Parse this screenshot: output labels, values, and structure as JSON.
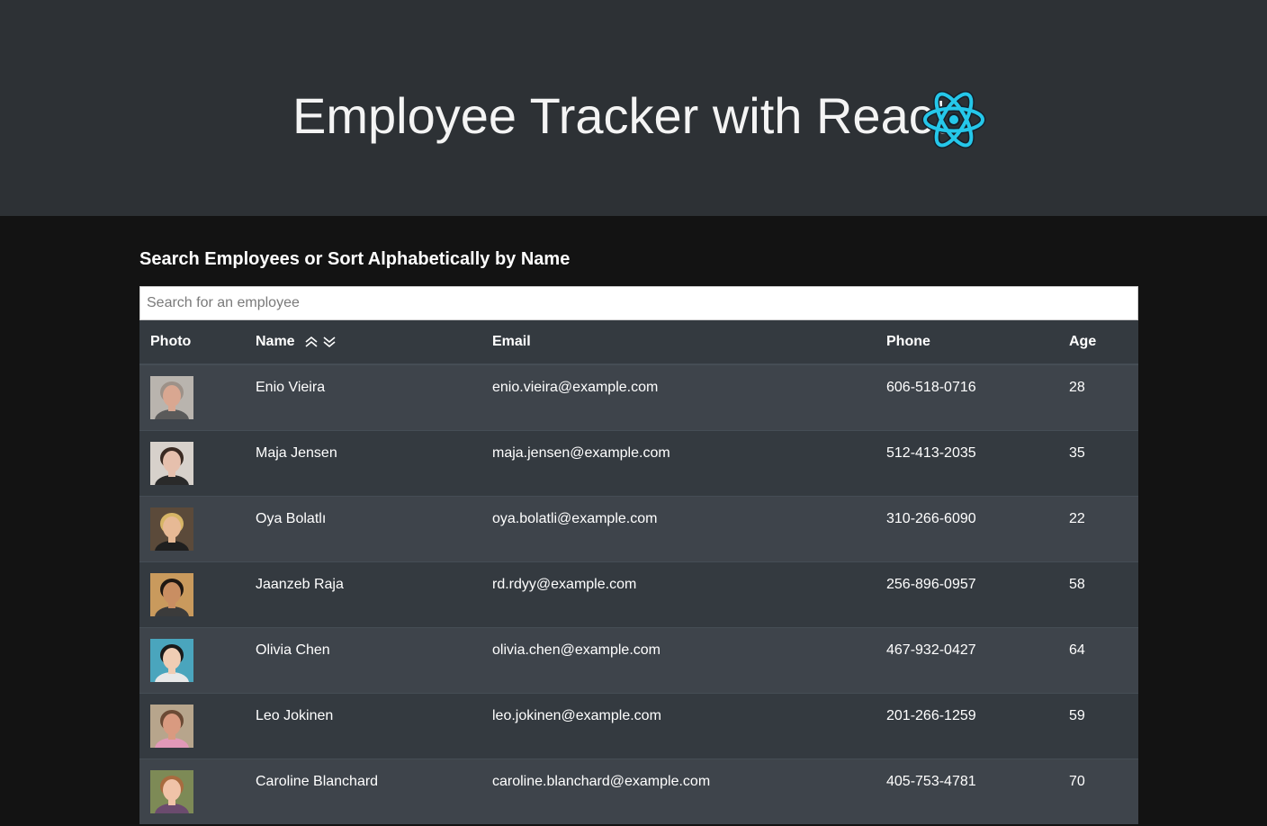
{
  "header": {
    "title": "Employee Tracker with React",
    "logo_icon": "react-logo-icon",
    "background": "#2d3135"
  },
  "search": {
    "heading": "Search Employees or Sort Alphabetically by Name",
    "placeholder": "Search for an employee",
    "value": ""
  },
  "table": {
    "columns": {
      "photo": "Photo",
      "name": "Name",
      "email": "Email",
      "phone": "Phone",
      "age": "Age"
    },
    "sort_icons": [
      "sort-ascending-icon",
      "sort-descending-icon"
    ],
    "rows": [
      {
        "name": "Enio Vieira",
        "email": "enio.vieira@example.com",
        "phone": "606-518-0716",
        "age": "28",
        "avatar": {
          "bg": "#b9b4ae",
          "skin": "#d9a791",
          "hair": "#9d9188",
          "shirt": "#5a5a5a"
        }
      },
      {
        "name": "Maja Jensen",
        "email": "maja.jensen@example.com",
        "phone": "512-413-2035",
        "age": "35",
        "avatar": {
          "bg": "#d7d1cb",
          "skin": "#e6c0ad",
          "hair": "#3a2a22",
          "shirt": "#2a2a2a"
        }
      },
      {
        "name": "Oya Bolatlı",
        "email": "oya.bolatli@example.com",
        "phone": "310-266-6090",
        "age": "22",
        "avatar": {
          "bg": "#5b4a3a",
          "skin": "#e7b995",
          "hair": "#d7b566",
          "shirt": "#1f1f1f"
        }
      },
      {
        "name": "Jaanzeb Raja",
        "email": "rd.rdyy@example.com",
        "phone": "256-896-0957",
        "age": "58",
        "avatar": {
          "bg": "#c99a5d",
          "skin": "#c98e62",
          "hair": "#1f1712",
          "shirt": "#3b3b3b"
        }
      },
      {
        "name": "Olivia Chen",
        "email": "olivia.chen@example.com",
        "phone": "467-932-0427",
        "age": "64",
        "avatar": {
          "bg": "#4aa5bd",
          "skin": "#f0cdb4",
          "hair": "#1a1a1a",
          "shirt": "#e8e8e8"
        }
      },
      {
        "name": "Leo Jokinen",
        "email": "leo.jokinen@example.com",
        "phone": "201-266-1259",
        "age": "59",
        "avatar": {
          "bg": "#b7a58c",
          "skin": "#d99a80",
          "hair": "#6b4a35",
          "shirt": "#e199b8"
        }
      },
      {
        "name": "Caroline Blanchard",
        "email": "caroline.blanchard@example.com",
        "phone": "405-753-4781",
        "age": "70",
        "avatar": {
          "bg": "#7d8a56",
          "skin": "#f0c3a8",
          "hair": "#a86b3f",
          "shirt": "#6b4b6e"
        }
      }
    ]
  }
}
